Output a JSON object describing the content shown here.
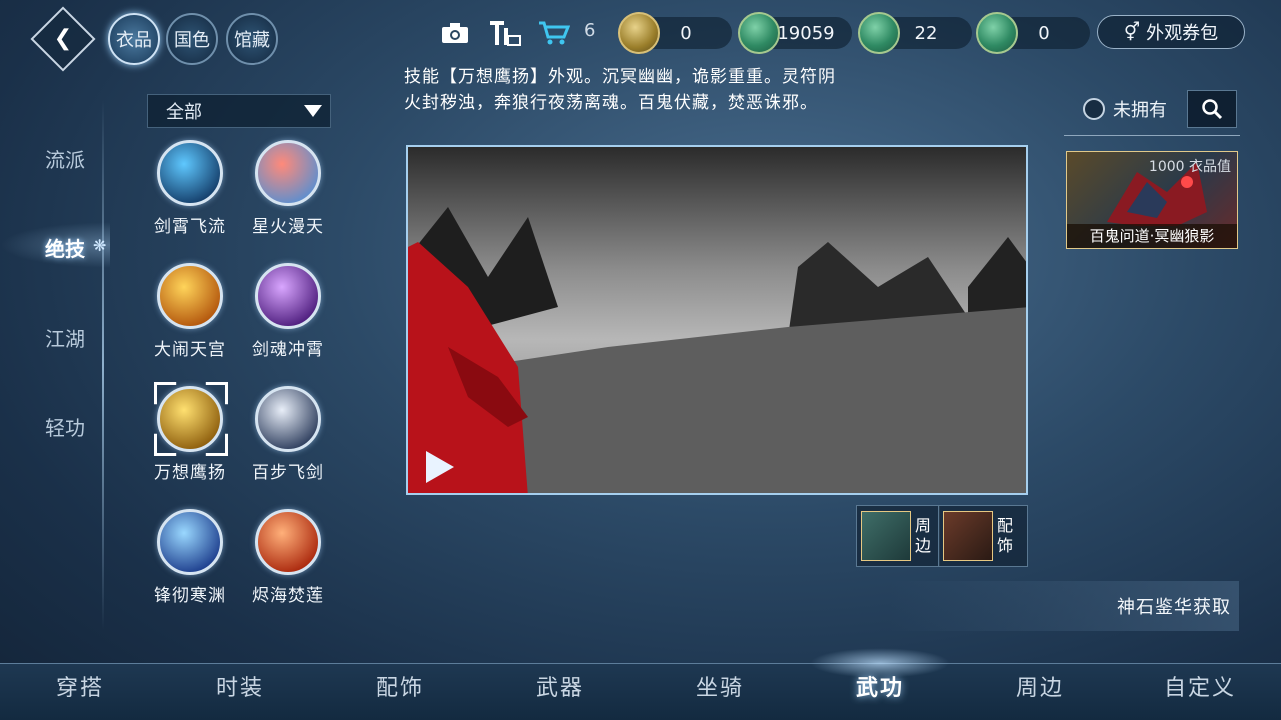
{
  "top": {
    "back_icon": "back-arrow-icon",
    "category_tabs": [
      {
        "label": "衣品",
        "active": true
      },
      {
        "label": "国色",
        "active": false
      },
      {
        "label": "馆藏",
        "active": false
      }
    ],
    "tool_icons": [
      "camera-icon",
      "shop-station-icon",
      "cart-icon"
    ],
    "cart_count": "6",
    "currencies": [
      {
        "icon": "gold-coin-icon",
        "value": "0"
      },
      {
        "icon": "jade-coin-icon",
        "value": "19059"
      },
      {
        "icon": "jade-token-icon",
        "value": "22"
      },
      {
        "icon": "jade-ticket-icon",
        "value": "0"
      }
    ],
    "voucher_label": "外观券包"
  },
  "sidebar": {
    "items": [
      {
        "label": "流派",
        "active": false
      },
      {
        "label": "绝技",
        "active": true
      },
      {
        "label": "江湖",
        "active": false
      },
      {
        "label": "轻功",
        "active": false
      }
    ]
  },
  "filter": {
    "selected": "全部"
  },
  "skills": [
    {
      "label": "剑霄飞流",
      "color_a": "#5fc8ff",
      "color_b": "#123a66",
      "selected": false
    },
    {
      "label": "星火漫天",
      "color_a": "#ff8a7a",
      "color_b": "#5a8fd0",
      "selected": false
    },
    {
      "label": "大闹天宫",
      "color_a": "#ffd45a",
      "color_b": "#b0520a",
      "selected": false
    },
    {
      "label": "剑魂冲霄",
      "color_a": "#d9a6ff",
      "color_b": "#4a1a7a",
      "selected": false
    },
    {
      "label": "万想鹰扬",
      "color_a": "#ffe070",
      "color_b": "#8a5a0a",
      "selected": true
    },
    {
      "label": "百步飞剑",
      "color_a": "#e8eef8",
      "color_b": "#2a3a5a",
      "selected": false
    },
    {
      "label": "锋彻寒渊",
      "color_a": "#9ad8ff",
      "color_b": "#1a3a8a",
      "selected": false
    },
    {
      "label": "烬海焚莲",
      "color_a": "#ffb07a",
      "color_b": "#a8240a",
      "selected": false
    }
  ],
  "description": "技能【万想鹰扬】外观。沉冥幽幽，诡影重重。灵符阴火封秽浊，奔狼行夜荡离魂。百鬼伏藏，焚恶诛邪。",
  "preview": {
    "play_icon": "play-icon"
  },
  "related": [
    {
      "label": "周边"
    },
    {
      "label": "配饰"
    }
  ],
  "source": "神石鉴华获取",
  "right_panel": {
    "not_owned_label": "未拥有",
    "search_icon": "search-icon",
    "item_card": {
      "value_text": "1000 衣品值",
      "name": "百鬼问道·冥幽狼影"
    }
  },
  "bottom_tabs": [
    {
      "label": "穿搭",
      "active": false
    },
    {
      "label": "时装",
      "active": false
    },
    {
      "label": "配饰",
      "active": false
    },
    {
      "label": "武器",
      "active": false
    },
    {
      "label": "坐骑",
      "active": false
    },
    {
      "label": "武功",
      "active": true
    },
    {
      "label": "周边",
      "active": false
    },
    {
      "label": "自定义",
      "active": false
    }
  ]
}
